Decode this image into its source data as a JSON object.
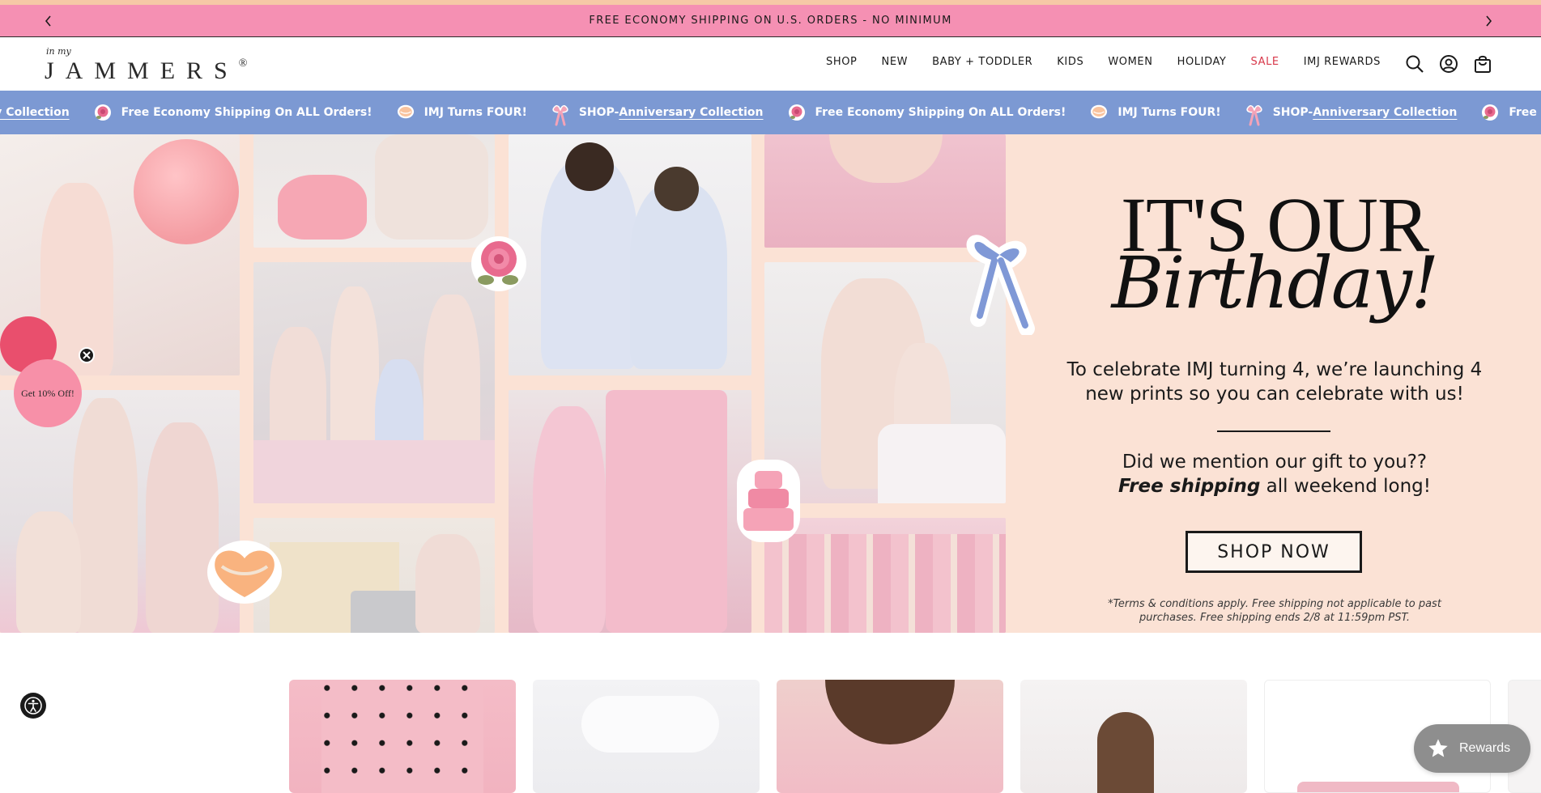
{
  "announcement": {
    "text": "FREE ECONOMY SHIPPING ON U.S. ORDERS - NO MINIMUM",
    "prev_icon": "chevron-left-icon",
    "next_icon": "chevron-right-icon"
  },
  "brand": {
    "logo_small": "in my",
    "logo_big": "JAMMERS",
    "logo_mark": "®"
  },
  "nav": {
    "items": [
      "SHOP",
      "NEW",
      "BABY + TODDLER",
      "KIDS",
      "WOMEN",
      "HOLIDAY",
      "SALE",
      "IMJ REWARDS"
    ],
    "sale_color": "#d8394b"
  },
  "header_icons": [
    "search-icon",
    "account-icon",
    "bag-icon"
  ],
  "marquee": {
    "items": [
      {
        "prefix": "SHOP- ",
        "link": "Anniversary Collection",
        "icon": "bow-icon"
      },
      {
        "prefix": "Free Economy Shipping On ALL Orders!",
        "link": "",
        "icon": "rose-icon"
      },
      {
        "prefix": "IMJ Turns FOUR!",
        "link": "",
        "icon": "cake-icon"
      },
      {
        "prefix": "SHOP- ",
        "link": "Anniversary Collection",
        "icon": "bow-icon"
      },
      {
        "prefix": "Free Economy Shipping On ALL Orders!",
        "link": "",
        "icon": "rose-icon"
      },
      {
        "prefix": "IMJ Turns FOUR!",
        "link": "",
        "icon": "cake-icon"
      },
      {
        "prefix": "SHOP- ",
        "link": "Anniversary Collection",
        "icon": "bow-icon"
      },
      {
        "prefix": "Free Economy Shipping On ALL Orders!",
        "link": "",
        "icon": "rose-icon"
      }
    ],
    "bg": "#7c99d3"
  },
  "hero": {
    "title_line1": "IT'S OUR",
    "title_line2": "Birthday!",
    "body": "To celebrate IMJ turning 4, we’re launching 4 new prints so you can celebrate with us!",
    "gift_line1": "Did we mention our gift to you??",
    "gift_bold": "Free shipping",
    "gift_rest": " all weekend long!",
    "cta": "SHOP NOW",
    "terms": "*Terms & conditions apply. Free shipping not applicable to past purchases. Free shipping ends 2/8 at 11:59pm PST.",
    "bg": "#fbe2d5"
  },
  "promo": {
    "label": "Get 10% Off!",
    "close_icon": "close-icon"
  },
  "accessibility": {
    "icon": "accessibility-icon"
  },
  "rewards": {
    "label": "Rewards",
    "icon": "star-icon"
  }
}
